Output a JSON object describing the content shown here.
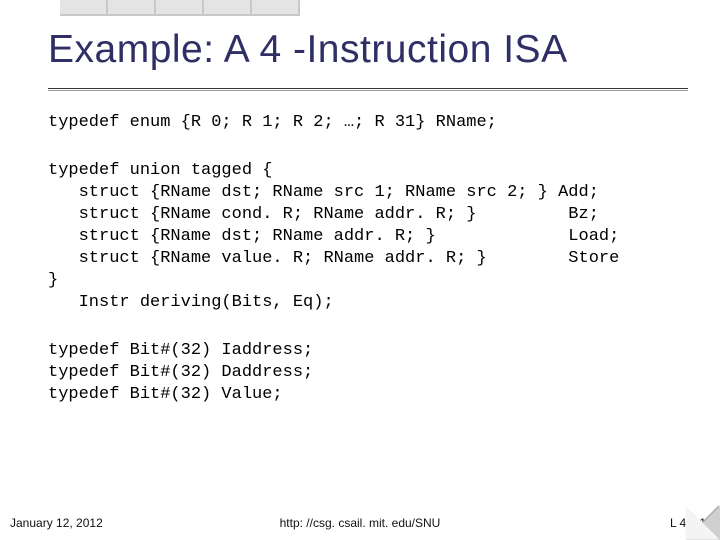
{
  "title": "Example: A 4 -Instruction ISA",
  "code_block1": "typedef enum {R 0; R 1; R 2; …; R 31} RName;",
  "code_block2": "typedef union tagged {\n   struct {RName dst; RName src 1; RName src 2; } Add;\n   struct {RName cond. R; RName addr. R; }         Bz;\n   struct {RName dst; RName addr. R; }             Load;\n   struct {RName value. R; RName addr. R; }        Store\n}\n   Instr deriving(Bits, Eq);",
  "code_block3": "typedef Bit#(32) Iaddress;\ntypedef Bit#(32) Daddress;\ntypedef Bit#(32) Value;",
  "footer": {
    "date": "January 12, 2012",
    "url": "http: //csg. csail. mit. edu/SNU",
    "page": "L 4 -11"
  }
}
